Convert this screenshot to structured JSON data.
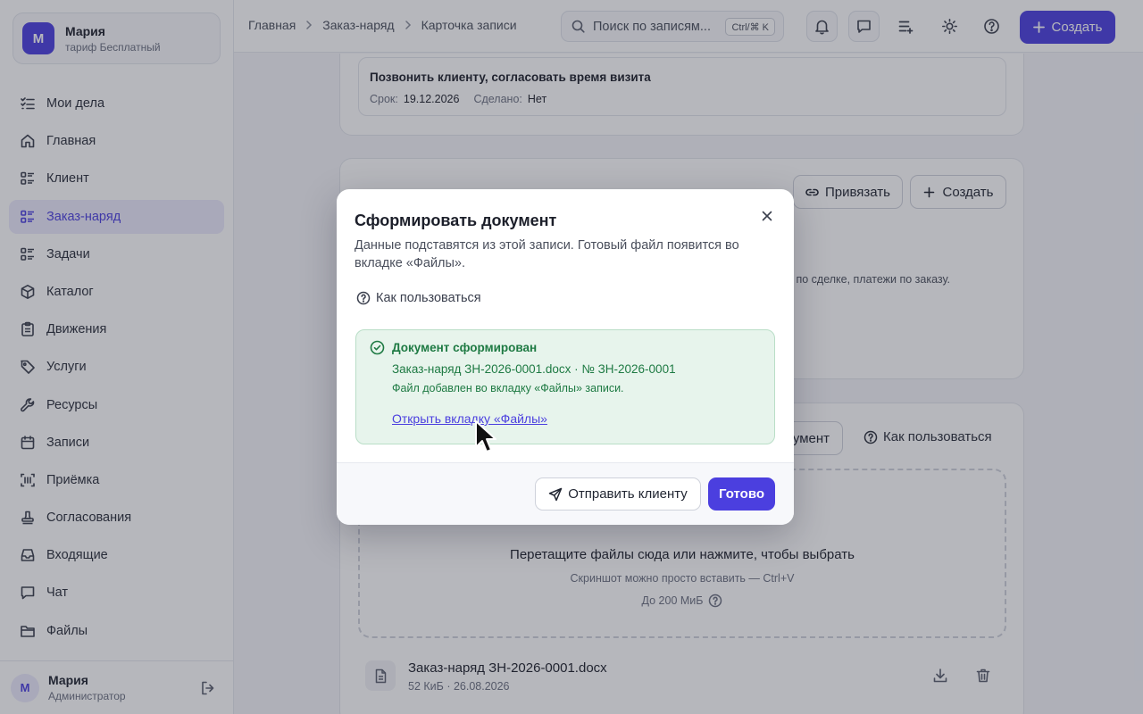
{
  "account": {
    "avatar_letter": "М",
    "name": "Мария",
    "plan": "тариф Бесплатный"
  },
  "nav": [
    {
      "label": "Мои дела",
      "icon": "checklist-icon"
    },
    {
      "label": "Главная",
      "icon": "home-icon"
    },
    {
      "label": "Клиент",
      "icon": "list-icon"
    },
    {
      "label": "Заказ-наряд",
      "icon": "list-icon",
      "active": true
    },
    {
      "label": "Задачи",
      "icon": "list-icon"
    },
    {
      "label": "Каталог",
      "icon": "box-icon"
    },
    {
      "label": "Движения",
      "icon": "clipboard-icon"
    },
    {
      "label": "Услуги",
      "icon": "tag-icon"
    },
    {
      "label": "Ресурсы",
      "icon": "wrench-icon"
    },
    {
      "label": "Записи",
      "icon": "calendar-icon"
    },
    {
      "label": "Приёмка",
      "icon": "barcode-icon"
    },
    {
      "label": "Согласования",
      "icon": "stamp-icon"
    },
    {
      "label": "Входящие",
      "icon": "inbox-icon"
    },
    {
      "label": "Чат",
      "icon": "chat-icon"
    },
    {
      "label": "Файлы",
      "icon": "folder-icon"
    }
  ],
  "user": {
    "avatar_letter": "М",
    "name": "Мария",
    "role": "Администратор"
  },
  "breadcrumbs": [
    "Главная",
    "Заказ-наряд",
    "Карточка записи"
  ],
  "search": {
    "placeholder": "Поиск по записям...",
    "shortcut": "Ctrl/⌘ K"
  },
  "header": {
    "create_label": "Создать"
  },
  "task": {
    "title": "Позвонить клиенту, согласовать время визита",
    "deadline_label": "Срок:",
    "deadline": "19.12.2026",
    "done_label": "Сделано:",
    "done": "Нет"
  },
  "payments": {
    "bind_label": "Привязать",
    "create_label": "Создать",
    "hint": "и по сделке, платежи по заказу."
  },
  "files": {
    "doc_button_tail": "умент",
    "help_label": "Как пользоваться",
    "drop_main": "Перетащите файлы сюда или нажмите, чтобы выбрать",
    "drop_sub": "Скриншот можно просто вставить — Ctrl+V",
    "drop_limit": "До 200 МиБ",
    "file_name": "Заказ-наряд ЗН-2026-0001.docx",
    "file_meta": "52 КиБ · 26.08.2026"
  },
  "modal": {
    "title": "Сформировать документ",
    "description": "Данные подставятся из этой записи. Готовый файл появится во вкладке «Файлы».",
    "help_label": "Как пользоваться",
    "success_title": "Документ сформирован",
    "success_file": "Заказ-наряд ЗН-2026-0001.docx · № ЗН-2026-0001",
    "success_note": "Файл добавлен во вкладку «Файлы» записи.",
    "success_link": "Открыть вкладку «Файлы»",
    "send_label": "Отправить клиенту",
    "done_label": "Готово"
  },
  "colors": {
    "accent": "#4b3fdf",
    "success": "#1e7a43",
    "success_bg": "#e7f4ec"
  }
}
